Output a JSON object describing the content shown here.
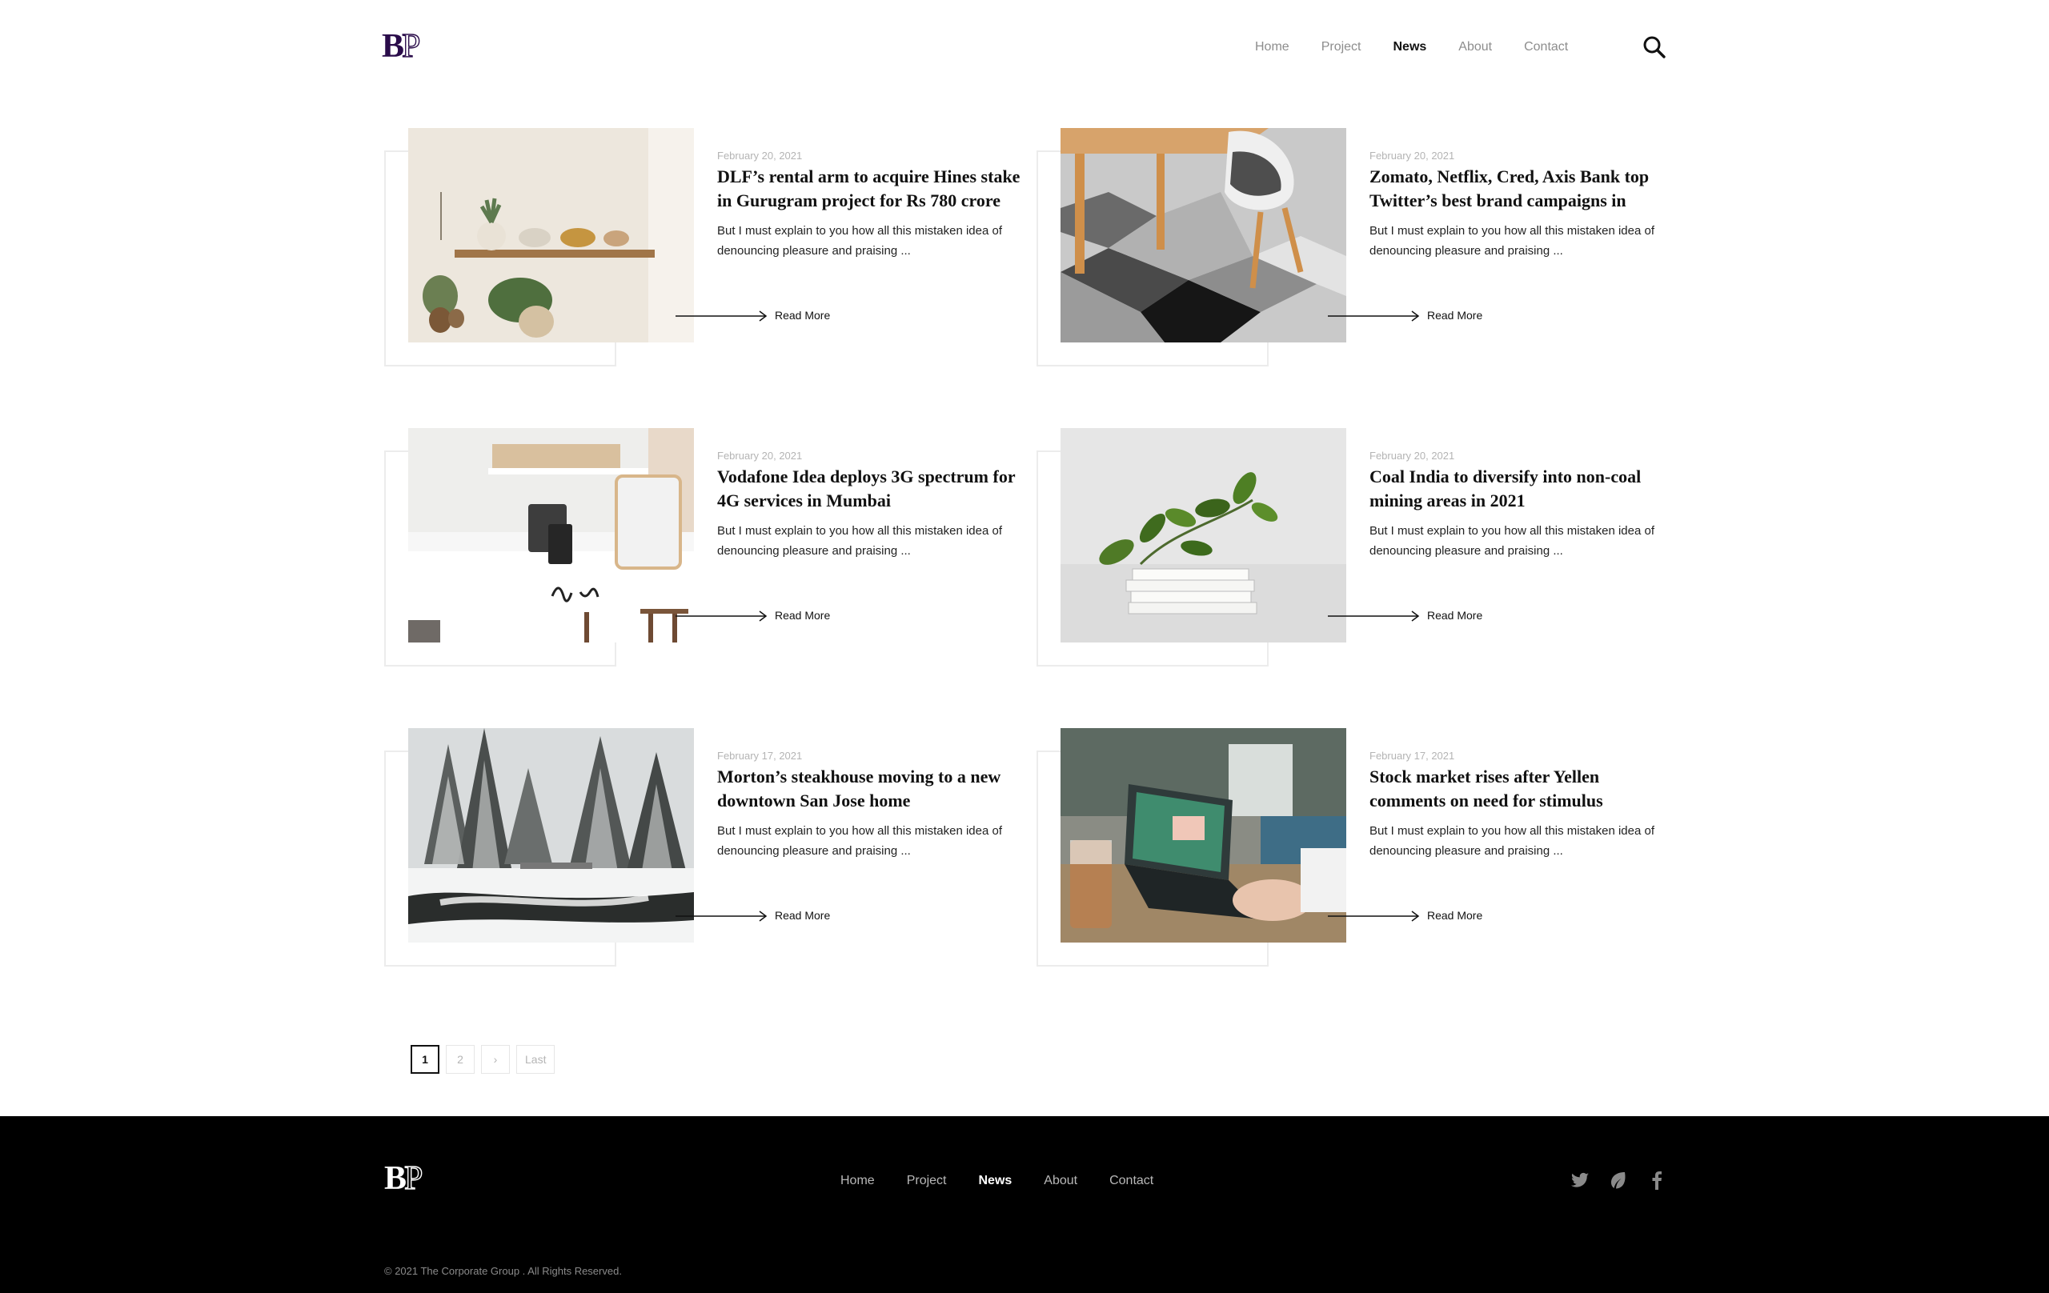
{
  "brand": {
    "logo_b": "B",
    "logo_p": "P"
  },
  "nav": [
    {
      "label": "Home",
      "active": false
    },
    {
      "label": "Project",
      "active": false
    },
    {
      "label": "News",
      "active": true
    },
    {
      "label": "About",
      "active": false
    },
    {
      "label": "Contact",
      "active": false
    }
  ],
  "icons": {
    "search": "search-icon",
    "arrow": "arrow-right-icon",
    "twitter": "twitter-icon",
    "leaf": "leaf-icon",
    "facebook": "facebook-icon"
  },
  "posts": [
    {
      "date": "February 20, 2021",
      "title": "DLF’s rental arm to acquire Hines stake in Gurugram project for Rs 780 crore",
      "excerpt": "But I must explain to you how all this mistaken idea of denouncing pleasure and praising ...",
      "cta": "Read More"
    },
    {
      "date": "February 20, 2021",
      "title": "Zomato, Netflix, Cred, Axis Bank top Twitter’s best brand campaigns in",
      "excerpt": "But I must explain to you how all this mistaken idea of denouncing pleasure and praising ...",
      "cta": "Read More"
    },
    {
      "date": "February 20, 2021",
      "title": "Vodafone Idea deploys 3G spectrum for 4G services in Mumbai",
      "excerpt": "But I must explain to you how all this mistaken idea of denouncing pleasure and praising ...",
      "cta": "Read More"
    },
    {
      "date": "February 20, 2021",
      "title": "Coal India to diversify into non-coal mining areas in 2021",
      "excerpt": "But I must explain to you how all this mistaken idea of denouncing pleasure and praising ...",
      "cta": "Read More"
    },
    {
      "date": "February 17, 2021",
      "title": "Morton’s steakhouse moving to a new downtown San Jose home",
      "excerpt": "But I must explain to you how all this mistaken idea of denouncing pleasure and praising ...",
      "cta": "Read More"
    },
    {
      "date": "February 17, 2021",
      "title": "Stock market rises after Yellen comments on need for stimulus",
      "excerpt": "But I must explain to you how all this mistaken idea of denouncing pleasure and praising ...",
      "cta": "Read More"
    }
  ],
  "pagination": {
    "current": "1",
    "next_page": "2",
    "next_arrow": "›",
    "last": "Last"
  },
  "footer": {
    "nav": [
      {
        "label": "Home",
        "active": false
      },
      {
        "label": "Project",
        "active": false
      },
      {
        "label": "News",
        "active": true
      },
      {
        "label": "About",
        "active": false
      },
      {
        "label": "Contact",
        "active": false
      }
    ],
    "copyright": "© 2021 The Corporate Group . All Rights Reserved."
  },
  "colors": {
    "brand_purple": "#2a0c4a",
    "footer_bg": "#000000",
    "frame": "#ececec"
  }
}
